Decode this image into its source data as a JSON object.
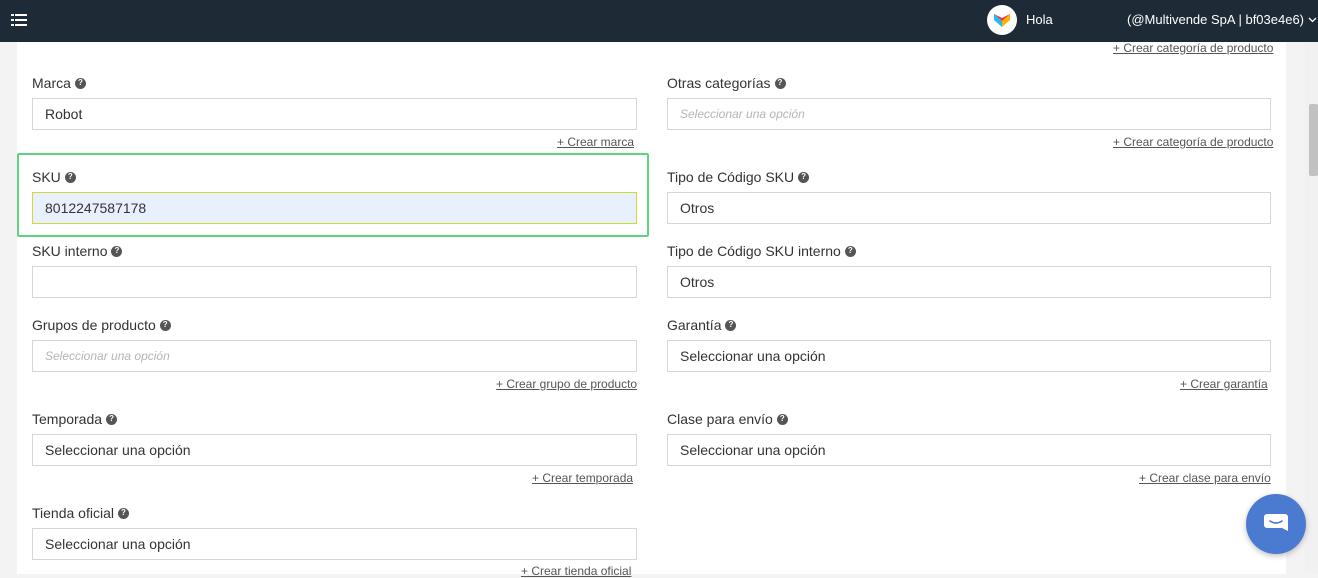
{
  "topbar": {
    "greeting": "Hola",
    "account": "(@Multivende SpA | bf03e4e6)"
  },
  "links": {
    "top_create_category": "+ Crear categoría de producto",
    "create_brand": "+ Crear marca",
    "create_category": "+ Crear categoría de producto",
    "create_group": "+ Crear grupo de producto",
    "create_warranty": "+ Crear garantía",
    "create_season": "+ Crear temporada",
    "create_shipping_class": "+ Crear clase para envío",
    "create_official_store": "+ Crear tienda oficial"
  },
  "fields": {
    "brand": {
      "label": "Marca",
      "value": "Robot"
    },
    "other_categories": {
      "label": "Otras categorías",
      "placeholder": "Seleccionar una opción"
    },
    "sku": {
      "label": "SKU",
      "value": "8012247587178"
    },
    "sku_code_type": {
      "label": "Tipo de Código SKU",
      "value": "Otros"
    },
    "internal_sku": {
      "label": "SKU interno",
      "value": ""
    },
    "internal_sku_code_type": {
      "label": "Tipo de Código SKU interno",
      "value": "Otros"
    },
    "product_groups": {
      "label": "Grupos de producto",
      "placeholder": "Seleccionar una opción"
    },
    "warranty": {
      "label": "Garantía",
      "value": "Seleccionar una opción"
    },
    "season": {
      "label": "Temporada",
      "value": "Seleccionar una opción"
    },
    "shipping_class": {
      "label": "Clase para envío",
      "value": "Seleccionar una opción"
    },
    "official_store": {
      "label": "Tienda oficial",
      "value": "Seleccionar una opción"
    }
  },
  "colors": {
    "topbar_bg": "#1e2a35",
    "highlight_border": "#5fd47e",
    "chat_button": "#4a7bd1"
  }
}
